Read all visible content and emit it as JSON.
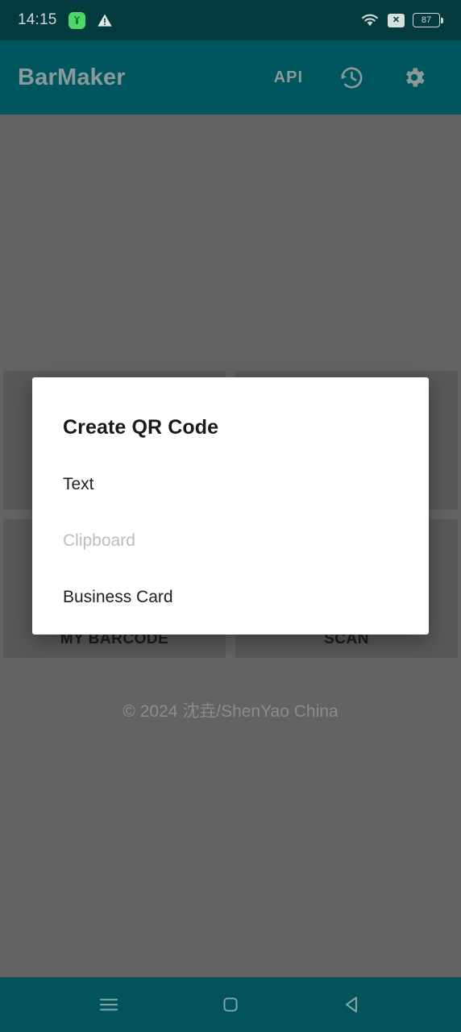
{
  "status_bar": {
    "clock": "14:15",
    "battery_percent": "87",
    "icons": {
      "app_notification": "app-notification-icon",
      "warning": "warning-triangle-icon",
      "wifi": "wifi-icon",
      "no_signal": "x-badge-icon",
      "battery": "battery-icon"
    }
  },
  "app_bar": {
    "title": "BarMaker",
    "api_label": "API",
    "history_icon": "history-icon",
    "settings_icon": "gear-icon"
  },
  "background": {
    "buttons": [
      {
        "label": "MY BARCODE"
      },
      {
        "label": "SCAN"
      }
    ],
    "copyright": "© 2024 沈垚/ShenYao China"
  },
  "dialog": {
    "title": "Create QR Code",
    "items": [
      {
        "label": "Text",
        "disabled": false
      },
      {
        "label": "Clipboard",
        "disabled": true
      },
      {
        "label": "Business Card",
        "disabled": false
      }
    ]
  },
  "nav_bar": {
    "recents_icon": "menu-icon",
    "home_icon": "home-square-icon",
    "back_icon": "back-triangle-icon"
  },
  "colors": {
    "status_bar": "#023A3D",
    "app_bar": "#00565E",
    "nav_bar": "#02545A",
    "scrim": "#636363",
    "dialog_bg": "#FFFFFF",
    "accent_green": "#4CD66B"
  }
}
